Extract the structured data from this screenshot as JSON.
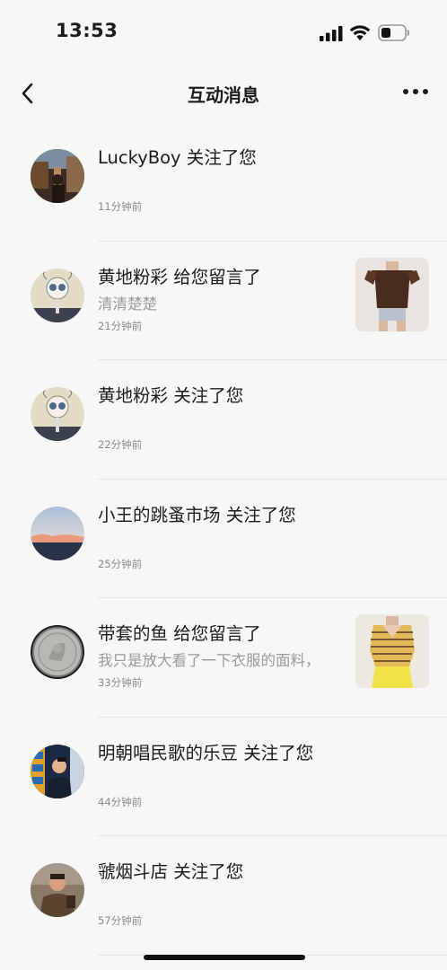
{
  "status_bar": {
    "time": "13:53"
  },
  "nav": {
    "title": "互动消息"
  },
  "messages": [
    {
      "title": "LuckyBoy 关注了您",
      "subtitle": "",
      "time": "11分钟前"
    },
    {
      "title": "黄地粉彩 给您留言了",
      "subtitle": "清清楚楚",
      "time": "21分钟前"
    },
    {
      "title": "黄地粉彩 关注了您",
      "subtitle": "",
      "time": "22分钟前"
    },
    {
      "title": "小王的跳蚤市场 关注了您",
      "subtitle": "",
      "time": "25分钟前"
    },
    {
      "title": "带套的鱼 给您留言了",
      "subtitle": "我只是放大看了一下衣服的面料，",
      "time": "33分钟前"
    },
    {
      "title": "明朝唱民歌的乐豆 关注了您",
      "subtitle": "",
      "time": "44分钟前"
    },
    {
      "title": "虢烟斗店 关注了您",
      "subtitle": "",
      "time": "57分钟前"
    }
  ],
  "colors": {
    "background": "#f7f7f7",
    "title_text": "#1c1c1c",
    "secondary_text": "#9a9a9a",
    "divider": "#e6e6e6"
  }
}
